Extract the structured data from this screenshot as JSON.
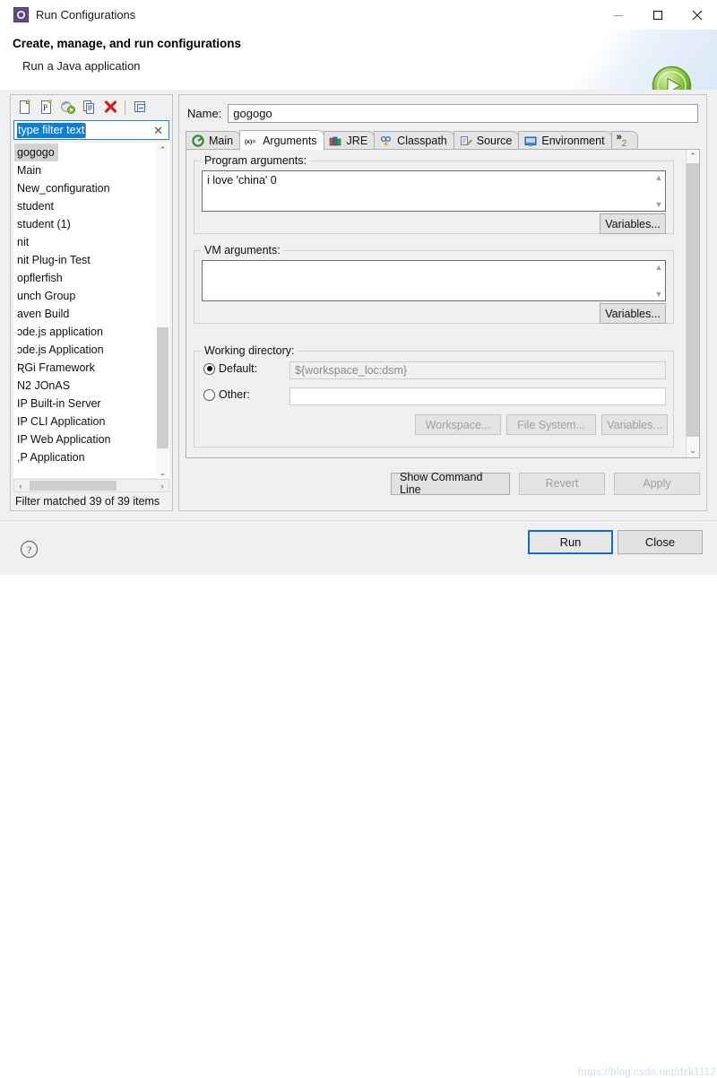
{
  "window": {
    "title": "Run Configurations",
    "title_icon": "run-configurations-icon",
    "minimize_label": "—",
    "maximize_label": "☐",
    "close_label": "✕"
  },
  "header": {
    "title": "Create, manage, and run configurations",
    "subtitle": "Run a Java application",
    "badge_icon": "green-run-play-icon"
  },
  "sidebar": {
    "toolbar": [
      {
        "name": "new-configuration-icon",
        "tooltip": "New launch configuration"
      },
      {
        "name": "new-prototype-icon",
        "tooltip": "New prototype"
      },
      {
        "name": "export-configuration-icon",
        "tooltip": "Export"
      },
      {
        "name": "duplicate-configuration-icon",
        "tooltip": "Duplicate"
      },
      {
        "name": "delete-configuration-icon",
        "tooltip": "Delete"
      },
      {
        "name": "collapse-all-icon",
        "tooltip": "Collapse All"
      }
    ],
    "filter": {
      "value": "type filter text",
      "clear_label": "✕"
    },
    "items": [
      {
        "label": "gogogo",
        "selected": true
      },
      {
        "label": "Main",
        "selected": false
      },
      {
        "label": "New_configuration",
        "selected": false
      },
      {
        "label": "student",
        "selected": false
      },
      {
        "label": "student (1)",
        "selected": false
      },
      {
        "label": "nit",
        "selected": false
      },
      {
        "label": "nit Plug-in Test",
        "selected": false
      },
      {
        "label": "opflerfish",
        "selected": false
      },
      {
        "label": "unch Group",
        "selected": false
      },
      {
        "label": "aven Build",
        "selected": false
      },
      {
        "label": "ɔde.js application",
        "selected": false
      },
      {
        "label": "ɔde.js Application",
        "selected": false
      },
      {
        "label": "ƦGi Framework",
        "selected": false
      },
      {
        "label": "N2 JOnAS",
        "selected": false
      },
      {
        "label": "IP Built-in Server",
        "selected": false
      },
      {
        "label": "IP CLI Application",
        "selected": false
      },
      {
        "label": "IP Web Application",
        "selected": false
      },
      {
        "label": ",P Application",
        "selected": false
      }
    ],
    "status": "Filter matched 39 of 39 items",
    "scroll_up_label": "⌃",
    "scroll_down_label": "⌄",
    "scroll_left_label": "‹",
    "scroll_right_label": "›"
  },
  "main": {
    "name_label": "Name:",
    "name_value": "gogogo",
    "tabs": [
      {
        "label": "Main",
        "icon": "main-tab-icon",
        "active": false
      },
      {
        "label": "Arguments",
        "icon": "arguments-tab-icon",
        "active": true
      },
      {
        "label": "JRE",
        "icon": "jre-tab-icon",
        "active": false
      },
      {
        "label": "Classpath",
        "icon": "classpath-tab-icon",
        "active": false
      },
      {
        "label": "Source",
        "icon": "source-tab-icon",
        "active": false
      },
      {
        "label": "Environment",
        "icon": "environment-tab-icon",
        "active": false
      }
    ],
    "tab_overflow": {
      "chevron": "»",
      "count": "2"
    },
    "program_arguments": {
      "title": "Program arguments:",
      "value": "i love 'china' 0",
      "variables_button": "Variables..."
    },
    "vm_arguments": {
      "title": "VM arguments:",
      "value": "",
      "variables_button": "Variables..."
    },
    "working_directory": {
      "title": "Working directory:",
      "default_label": "Default:",
      "default_value": "${workspace_loc:dsm}",
      "default_selected": true,
      "other_label": "Other:",
      "other_value": "",
      "other_selected": false,
      "workspace_button": "Workspace...",
      "file_system_button": "File System...",
      "variables_button": "Variables..."
    },
    "actions": {
      "show_command_line": "Show Command Line",
      "revert": "Revert",
      "apply": "Apply"
    }
  },
  "footer": {
    "help_icon": "help-question-icon",
    "run_button": "Run",
    "close_button": "Close",
    "watermark": "https://blog.csdn.net/dzk1112"
  }
}
